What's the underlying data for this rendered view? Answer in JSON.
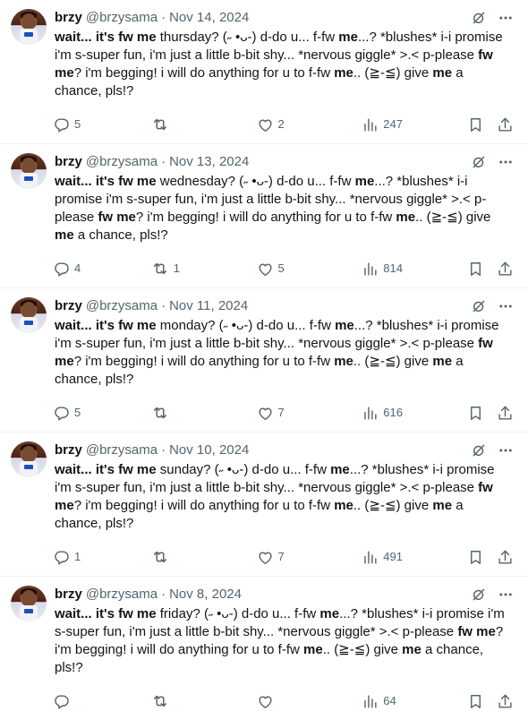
{
  "feed": {
    "tweets": [
      {
        "name": "brzy",
        "handle": "@brzysama",
        "date": "Nov 14, 2024",
        "text": [
          {
            "t": "wait... ",
            "b": true
          },
          {
            "t": "it's fw me",
            "b": true
          },
          {
            "t": " thursday? (˶ •ᴗ-) d-do u... f-fw ",
            "b": false
          },
          {
            "t": "me",
            "b": true
          },
          {
            "t": "...? *blushes* i-i promise i'm s-super fun, i'm just a little b-bit shy... *nervous giggle* >.< p-please ",
            "b": false
          },
          {
            "t": "fw me",
            "b": true
          },
          {
            "t": "? i'm begging! i will do anything for u to f-fw ",
            "b": false
          },
          {
            "t": "me",
            "b": true
          },
          {
            "t": ".. (≧-≦) give ",
            "b": false
          },
          {
            "t": "me",
            "b": true
          },
          {
            "t": " a chance, pls!?",
            "b": false
          }
        ],
        "lines": 3,
        "replies": "5",
        "retweets": "",
        "likes": "2",
        "views": "247"
      },
      {
        "name": "brzy",
        "handle": "@brzysama",
        "date": "Nov 13, 2024",
        "text": [
          {
            "t": "wait... ",
            "b": true
          },
          {
            "t": "it's fw me",
            "b": true
          },
          {
            "t": " wednesday? (˶ •ᴗ-) d-do u... f-fw ",
            "b": false
          },
          {
            "t": "me",
            "b": true
          },
          {
            "t": "...? *blushes* i-i promise i'm s-super fun, i'm just a little b-bit shy... *nervous giggle* >.< p-please ",
            "b": false
          },
          {
            "t": "fw me",
            "b": true
          },
          {
            "t": "? i'm begging! i will do anything for u to f-fw ",
            "b": false
          },
          {
            "t": "me",
            "b": true
          },
          {
            "t": ".. (≧-≦) give ",
            "b": false
          },
          {
            "t": "me",
            "b": true
          },
          {
            "t": " a chance, pls!?",
            "b": false
          }
        ],
        "lines": 4,
        "replies": "4",
        "retweets": "1",
        "likes": "5",
        "views": "814"
      },
      {
        "name": "brzy",
        "handle": "@brzysama",
        "date": "Nov 11, 2024",
        "text": [
          {
            "t": "wait... ",
            "b": true
          },
          {
            "t": "it's fw me",
            "b": true
          },
          {
            "t": " monday? (˶ •ᴗ-) d-do u... f-fw ",
            "b": false
          },
          {
            "t": "me",
            "b": true
          },
          {
            "t": "...? *blushes* i-i promise i'm s-super fun, i'm just a little b-bit shy... *nervous giggle* >.< p-please ",
            "b": false
          },
          {
            "t": "fw me",
            "b": true
          },
          {
            "t": "? i'm begging! i will do anything for u to f-fw ",
            "b": false
          },
          {
            "t": "me",
            "b": true
          },
          {
            "t": ".. (≧-≦) give ",
            "b": false
          },
          {
            "t": "me",
            "b": true
          },
          {
            "t": " a chance, pls!?",
            "b": false
          }
        ],
        "lines": 4,
        "replies": "5",
        "retweets": "",
        "likes": "7",
        "views": "616"
      },
      {
        "name": "brzy",
        "handle": "@brzysama",
        "date": "Nov 10, 2024",
        "text": [
          {
            "t": "wait... ",
            "b": true
          },
          {
            "t": "it's fw me",
            "b": true
          },
          {
            "t": " sunday? (˶ •ᴗ-) d-do u... f-fw ",
            "b": false
          },
          {
            "t": "me",
            "b": true
          },
          {
            "t": "...? *blushes* i-i promise i'm s-super fun, i'm just a little b-bit shy... *nervous giggle* >.< p-please ",
            "b": false
          },
          {
            "t": "fw me",
            "b": true
          },
          {
            "t": "? i'm begging! i will do anything for u to f-fw ",
            "b": false
          },
          {
            "t": "me",
            "b": true
          },
          {
            "t": ".. (≧-≦) give ",
            "b": false
          },
          {
            "t": "me",
            "b": true
          },
          {
            "t": " a chance, pls!?",
            "b": false
          }
        ],
        "lines": 4,
        "replies": "1",
        "retweets": "",
        "likes": "7",
        "views": "491"
      },
      {
        "name": "brzy",
        "handle": "@brzysama",
        "date": "Nov 8, 2024",
        "text": [
          {
            "t": "wait... ",
            "b": true
          },
          {
            "t": "it's fw me",
            "b": true
          },
          {
            "t": " friday? (˶ •ᴗ-) d-do u... f-fw ",
            "b": false
          },
          {
            "t": "me",
            "b": true
          },
          {
            "t": "...? *blushes* i-i promise i'm s-super fun, i'm just a little b-bit shy... *nervous giggle* >.< p-please ",
            "b": false
          },
          {
            "t": "fw me",
            "b": true
          },
          {
            "t": "? i'm begging! i will do anything for u to f-fw ",
            "b": false
          },
          {
            "t": "me",
            "b": true
          },
          {
            "t": ".. (≧-≦) give ",
            "b": false
          },
          {
            "t": "me",
            "b": true
          },
          {
            "t": " a chance, pls!?",
            "b": false
          }
        ],
        "lines": 4,
        "replies": "",
        "retweets": "",
        "likes": "",
        "views": "64"
      }
    ]
  },
  "icons": {
    "grok": "grok-icon",
    "more": "more-icon",
    "reply": "reply-icon",
    "retweet": "retweet-icon",
    "like": "like-icon",
    "views": "views-icon",
    "bookmark": "bookmark-icon",
    "share": "share-icon"
  },
  "colors": {
    "text": "#0f1419",
    "secondary": "#536471",
    "divider": "#eff3f4"
  }
}
